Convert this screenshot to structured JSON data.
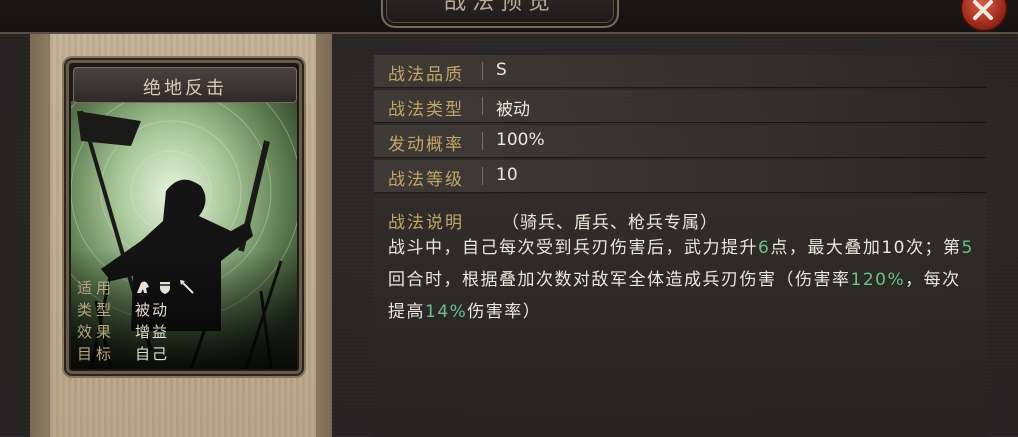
{
  "window": {
    "title": "战法预览",
    "close_icon": "close-icon"
  },
  "card": {
    "name": "绝地反击",
    "props": [
      {
        "label": "适用",
        "icons": [
          "cavalry-icon",
          "shield-icon",
          "spear-icon"
        ]
      },
      {
        "label": "类型",
        "value": "被动"
      },
      {
        "label": "效果",
        "value": "增益"
      },
      {
        "label": "目标",
        "value": "自己"
      }
    ]
  },
  "info": {
    "rows": [
      {
        "label": "战法品质",
        "value": "S"
      },
      {
        "label": "战法类型",
        "value": "被动"
      },
      {
        "label": "发动概率",
        "value": "100%"
      },
      {
        "label": "战法等级",
        "value": "10"
      }
    ],
    "description": {
      "label": "战法说明",
      "restriction": "（骑兵、盾兵、枪兵专属）",
      "segments": [
        {
          "text": "战斗中，自己每次受到兵刃伤害后，武力提升",
          "hl": false
        },
        {
          "text": "6",
          "hl": true
        },
        {
          "text": "点，最大叠加10次；第",
          "hl": false
        },
        {
          "text": "5",
          "hl": true
        },
        {
          "text": "回合时，根据叠加次数对敌军全体造成兵刃伤害（伤害率",
          "hl": false
        },
        {
          "text": "120%",
          "hl": true
        },
        {
          "text": "，每次提高",
          "hl": false
        },
        {
          "text": "14%",
          "hl": true
        },
        {
          "text": "伤害率）",
          "hl": false
        }
      ]
    }
  },
  "colors": {
    "label_gold": "#c2a56a",
    "highlight_green": "#6fbf8a",
    "value_text": "#ece6da"
  }
}
